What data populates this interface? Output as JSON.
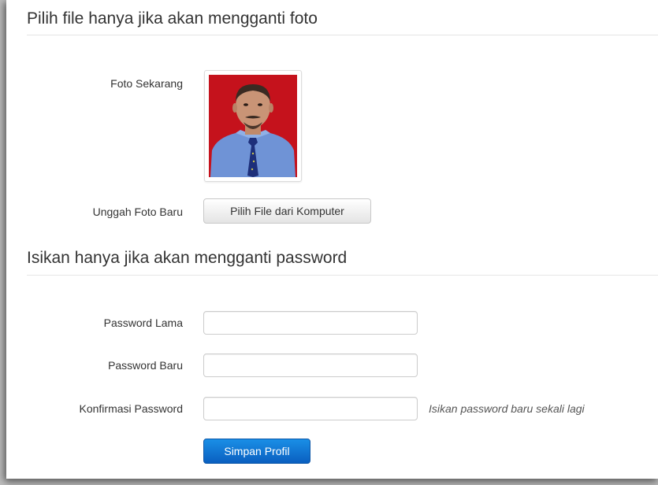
{
  "photo_section": {
    "title": "Pilih file hanya jika akan mengganti foto",
    "current_photo_label": "Foto Sekarang",
    "upload_label": "Unggah Foto Baru",
    "upload_button": "Pilih File dari Komputer"
  },
  "password_section": {
    "title": "Isikan hanya jika akan mengganti password",
    "old_password_label": "Password Lama",
    "old_password_value": "",
    "new_password_label": "Password Baru",
    "new_password_value": "",
    "confirm_password_label": "Konfirmasi Password",
    "confirm_password_value": "",
    "confirm_help": "Isikan password baru sekali lagi"
  },
  "submit_button": "Simpan Profil",
  "colors": {
    "primary_button": "#0a6fd6",
    "background": "#ffffff"
  }
}
